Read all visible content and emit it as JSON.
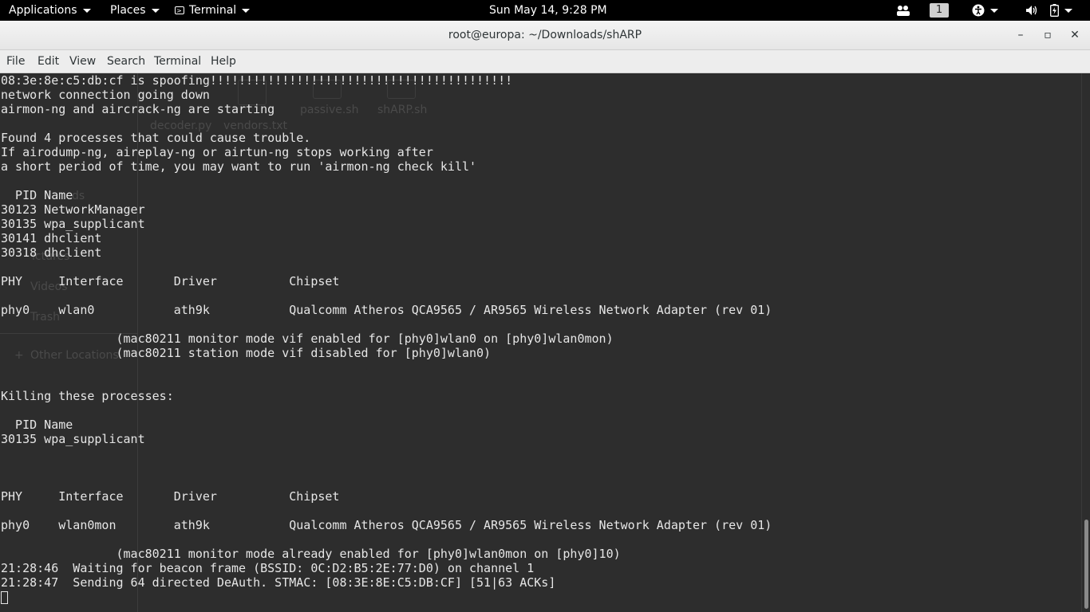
{
  "topbar": {
    "applications": "Applications",
    "places": "Places",
    "terminal": "Terminal",
    "clock": "Sun May 14,  9:28 PM",
    "workspace": "1"
  },
  "window": {
    "title": "root@europa: ~/Downloads/shARP",
    "minimize_icon": "–",
    "maximize_icon": "▫",
    "close_icon": "✕"
  },
  "menubar": [
    "File",
    "Edit",
    "View",
    "Search",
    "Terminal",
    "Help"
  ],
  "background_files": {
    "passive": "passive.sh",
    "sharp": "shARP.sh",
    "decoder": "decoder.py",
    "vendors": "vendors.txt",
    "ds": "ds",
    "pictures": "ictures",
    "videos": "Videos",
    "trash": "Trash",
    "other_locations": "Other Locations"
  },
  "terminal_lines": [
    "08:3e:8e:c5:db:cf is spoofing!!!!!!!!!!!!!!!!!!!!!!!!!!!!!!!!!!!!!!!!!!",
    "network connection going down",
    "airmon-ng and aircrack-ng are starting",
    "",
    "Found 4 processes that could cause trouble.",
    "If airodump-ng, aireplay-ng or airtun-ng stops working after",
    "a short period of time, you may want to run 'airmon-ng check kill'",
    "",
    "  PID Name",
    "30123 NetworkManager",
    "30135 wpa_supplicant",
    "30141 dhclient",
    "30318 dhclient",
    "",
    "PHY     Interface       Driver          Chipset",
    "",
    "phy0    wlan0           ath9k           Qualcomm Atheros QCA9565 / AR9565 Wireless Network Adapter (rev 01)",
    "",
    "                (mac80211 monitor mode vif enabled for [phy0]wlan0 on [phy0]wlan0mon)",
    "                (mac80211 station mode vif disabled for [phy0]wlan0)",
    "",
    "",
    "Killing these processes:",
    "",
    "  PID Name",
    "30135 wpa_supplicant",
    "",
    "",
    "",
    "PHY     Interface       Driver          Chipset",
    "",
    "phy0    wlan0mon        ath9k           Qualcomm Atheros QCA9565 / AR9565 Wireless Network Adapter (rev 01)",
    "",
    "                (mac80211 monitor mode already enabled for [phy0]wlan0mon on [phy0]10)",
    "21:28:46  Waiting for beacon frame (BSSID: 0C:D2:B5:2E:77:D0) on channel 1",
    "21:28:47  Sending 64 directed DeAuth. STMAC: [08:3E:8E:C5:DB:CF] [51|63 ACKs]"
  ]
}
